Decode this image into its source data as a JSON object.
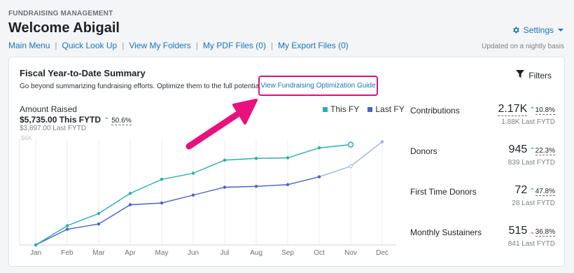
{
  "header": {
    "eyebrow": "FUNDRAISING MANAGEMENT",
    "welcome": "Welcome Abigail",
    "settings_label": "Settings",
    "updated": "Updated on a nightly basis"
  },
  "nav": {
    "links": [
      "Main Menu",
      "Quick Look Up",
      "View My Folders",
      "My PDF Files (0)",
      "My Export Files (0)"
    ],
    "separator": "|"
  },
  "card": {
    "title": "Fiscal Year-to-Date Summary",
    "description": "Go beyond summarizing fundraising efforts. Optimize them to the full potential.",
    "guide_link": "View Fundraising Optimization Guide",
    "filters_label": "Filters",
    "amount": {
      "label": "Amount Raised",
      "this_fytd": "$5,735.00 This FYTD",
      "change": "50.6%",
      "last_fytd": "$3,897.00 Last FYTD"
    },
    "legend": {
      "this_fy": "This FY",
      "last_fy": "Last FY"
    }
  },
  "colors": {
    "accent": "#1a74b8",
    "highlight": "#d9147c",
    "this_fy": "#2aaeae",
    "last_fy": "#4a63c4",
    "last_fy_projection": "#9fb1e6",
    "up": "#2e9e61",
    "down": "#d14848"
  },
  "metrics": [
    {
      "label": "Contributions",
      "value": "2.17K",
      "dashed": true,
      "direction": "up",
      "change": "10.8%",
      "last": "1.88K Last FYTD"
    },
    {
      "label": "Donors",
      "value": "945",
      "dashed": false,
      "direction": "up",
      "change": "22.3%",
      "last": "839 Last FYTD"
    },
    {
      "label": "First Time Donors",
      "value": "72",
      "dashed": false,
      "direction": "up",
      "change": "47.8%",
      "last": "28 Last FYTD"
    },
    {
      "label": "Monthly Sustainers",
      "value": "515",
      "dashed": false,
      "direction": "down",
      "change": "36.8%",
      "last": "841 Last FYTD"
    }
  ],
  "chart_data": {
    "type": "line",
    "categories": [
      "Jan",
      "Feb",
      "Mar",
      "Apr",
      "May",
      "Jun",
      "Jul",
      "Aug",
      "Sep",
      "Oct",
      "Nov",
      "Dec"
    ],
    "y_tick_label": "$6K",
    "ylim": [
      0,
      6000
    ],
    "grid": true,
    "legend_position": "top-right",
    "series": [
      {
        "name": "This FY",
        "values": [
          0,
          1100,
          1800,
          2950,
          3750,
          4100,
          4850,
          4950,
          4980,
          5550,
          5735,
          null
        ]
      },
      {
        "name": "Last FY",
        "values": [
          0,
          900,
          1200,
          2300,
          2400,
          2850,
          3300,
          3350,
          3450,
          3897,
          4500,
          5900
        ],
        "last_actual_index": 9
      }
    ]
  }
}
